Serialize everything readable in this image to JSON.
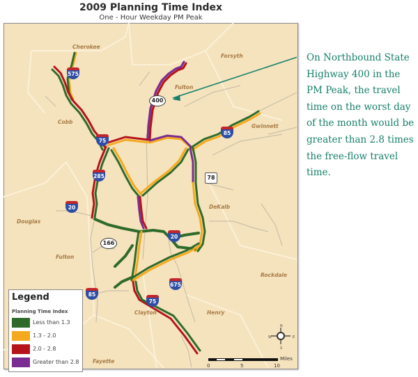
{
  "title": "2009 Planning Time Index",
  "subtitle": "One - Hour Weekday PM Peak",
  "callout": {
    "text": "On Northbound State Highway 400 in the PM Peak, the travel time on the worst day of the month would be greater than 2.8 times the free-flow travel time.",
    "color": "#16806b"
  },
  "legend": {
    "title": "Legend",
    "subtitle": "Planning Time Index",
    "items": [
      {
        "label": "Less than 1.3",
        "color": "#2e6b2a"
      },
      {
        "label": "1.3 - 2.0",
        "color": "#f5a91f"
      },
      {
        "label": "2.0 - 2.8",
        "color": "#b5141b"
      },
      {
        "label": "Greater than 2.8",
        "color": "#7b2c91"
      }
    ]
  },
  "counties": [
    "Cherokee",
    "Forsyth",
    "Fulton",
    "Cobb",
    "Gwinnett",
    "DeKalb",
    "Douglas",
    "Fulton",
    "Rockdale",
    "Clayton",
    "Henry",
    "Fayette"
  ],
  "shields": {
    "interstates": [
      "575",
      "75",
      "85",
      "285",
      "20",
      "20",
      "675",
      "85",
      "75"
    ],
    "state_routes": [
      "400",
      "166"
    ],
    "us_routes": [
      "78"
    ]
  },
  "scale": {
    "ticks": [
      "0",
      "5",
      "10"
    ],
    "unit": "Miles"
  },
  "compass": {
    "n": "N",
    "s": "S",
    "e": "E",
    "w": "W"
  }
}
